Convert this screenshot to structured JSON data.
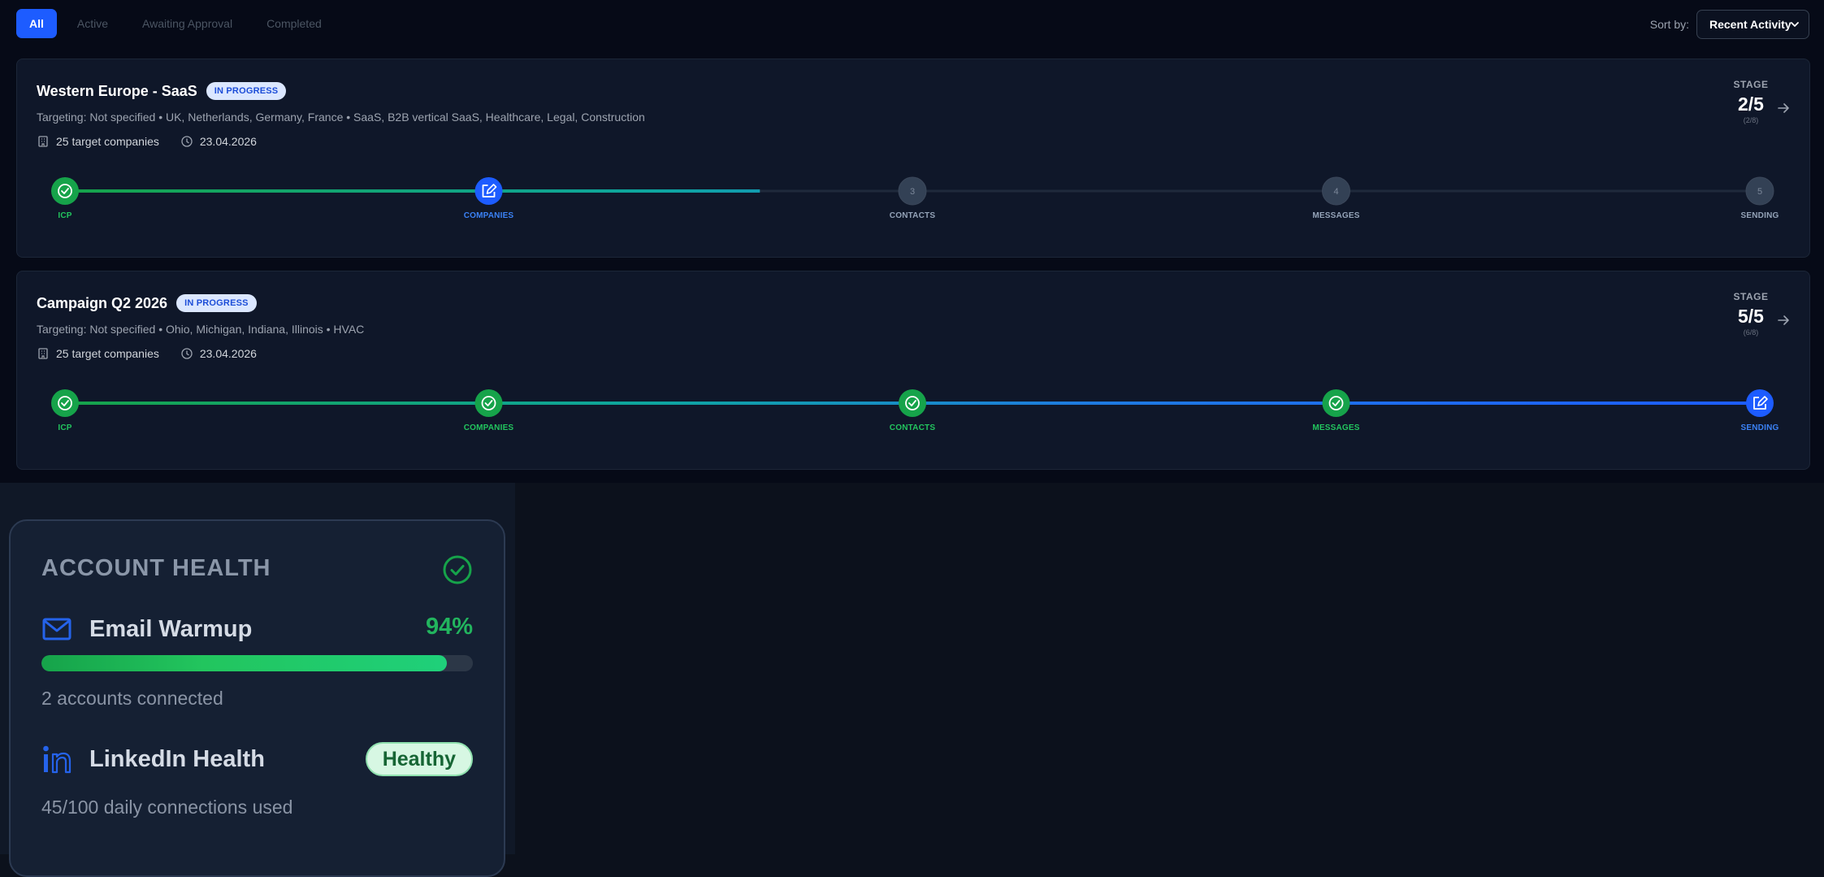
{
  "filters": {
    "tabs": [
      {
        "label": "All",
        "active": true
      },
      {
        "label": "Active",
        "active": false
      },
      {
        "label": "Awaiting Approval",
        "active": false
      },
      {
        "label": "Completed",
        "active": false
      }
    ],
    "sort_label": "Sort by:",
    "sort_value": "Recent Activity"
  },
  "campaigns": [
    {
      "title": "Western Europe - SaaS",
      "status": "IN PROGRESS",
      "targeting": "Targeting: Not specified • UK, Netherlands, Germany, France • SaaS, B2B vertical SaaS, Healthcare, Legal, Construction",
      "companies": "25 target companies",
      "date": "23.04.2026",
      "stage_label": "STAGE",
      "stage_value": "2/5",
      "stage_sub": "(2/8)",
      "steps": [
        {
          "label": "ICP",
          "state": "done",
          "num": "1"
        },
        {
          "label": "COMPANIES",
          "state": "current",
          "num": "2"
        },
        {
          "label": "CONTACTS",
          "state": "pending",
          "num": "3"
        },
        {
          "label": "MESSAGES",
          "state": "pending",
          "num": "4"
        },
        {
          "label": "SENDING",
          "state": "pending",
          "num": "5"
        }
      ],
      "progress_fraction": 0.41
    },
    {
      "title": "Campaign Q2 2026",
      "status": "IN PROGRESS",
      "targeting": "Targeting: Not specified • Ohio, Michigan, Indiana, Illinois • HVAC",
      "companies": "25 target companies",
      "date": "23.04.2026",
      "stage_label": "STAGE",
      "stage_value": "5/5",
      "stage_sub": "(6/8)",
      "steps": [
        {
          "label": "ICP",
          "state": "done",
          "num": "1"
        },
        {
          "label": "COMPANIES",
          "state": "done",
          "num": "2"
        },
        {
          "label": "CONTACTS",
          "state": "done",
          "num": "3"
        },
        {
          "label": "MESSAGES",
          "state": "done",
          "num": "4"
        },
        {
          "label": "SENDING",
          "state": "current",
          "num": "5"
        }
      ],
      "progress_fraction": 1.0
    }
  ],
  "health": {
    "title": "ACCOUNT HEALTH",
    "email_label": "Email Warmup",
    "email_pct": "94%",
    "email_progress": 0.94,
    "email_sub": "2 accounts connected",
    "linkedin_label": "LinkedIn Health",
    "linkedin_status": "Healthy",
    "linkedin_sub": "45/100 daily connections used"
  },
  "colors": {
    "accent": "#1d5cff",
    "done": "#16a34a",
    "pending": "#334155",
    "text_done": "#22c55e",
    "text_current": "#3b82f6",
    "text_pending": "#94a3b8"
  },
  "icons": {
    "building": "building-icon",
    "clock": "clock-icon",
    "arrow": "arrow-right-icon",
    "check": "check-circle-icon",
    "edit": "edit-icon",
    "mail": "mail-icon",
    "linkedin": "linkedin-icon",
    "chevron": "chevron-down-icon"
  }
}
